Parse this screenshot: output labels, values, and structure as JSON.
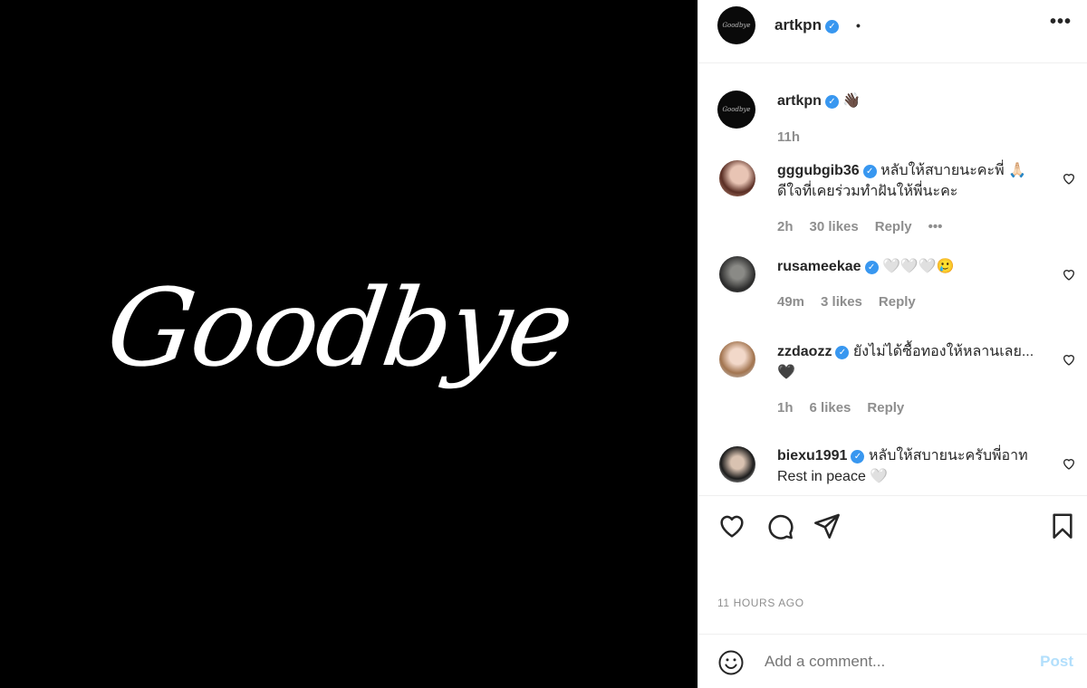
{
  "post": {
    "image_text": "Goodbye",
    "author": "artkpn",
    "header_separator": "•",
    "caption_emoji": "👋🏿",
    "caption_time": "11h",
    "timestamp": "11 HOURS AGO"
  },
  "comments": [
    {
      "user": "gggubgib36",
      "text": "หลับให้สบายนะคะพี่ 🙏🏻 ดีใจที่เคยร่วมทำฝันให้พี่นะคะ",
      "time": "2h",
      "likes": "30 likes",
      "reply": "Reply",
      "more": "•••"
    },
    {
      "user": "rusameekae",
      "text": "🤍🤍🤍🥲",
      "time": "49m",
      "likes": "3 likes",
      "reply": "Reply"
    },
    {
      "user": "zzdaozz",
      "text": "ยังไม่ได้ซื้อทองให้หลานเลย...🖤",
      "time": "1h",
      "likes": "6 likes",
      "reply": "Reply"
    },
    {
      "user": "biexu1991",
      "text": "หลับให้สบายนะครับพี่อาท Rest in peace 🤍"
    }
  ],
  "verified_mark": "✓",
  "add_comment": {
    "placeholder": "Add a comment...",
    "post_label": "Post"
  },
  "icons": [
    "more-options-icon",
    "like-icon",
    "comment-icon",
    "share-icon",
    "save-icon",
    "emoji-icon",
    "small-heart-icon"
  ],
  "colors": {
    "verified": "#3897f0",
    "post_disabled": "#b2dffc",
    "muted": "#8e8e8e"
  }
}
